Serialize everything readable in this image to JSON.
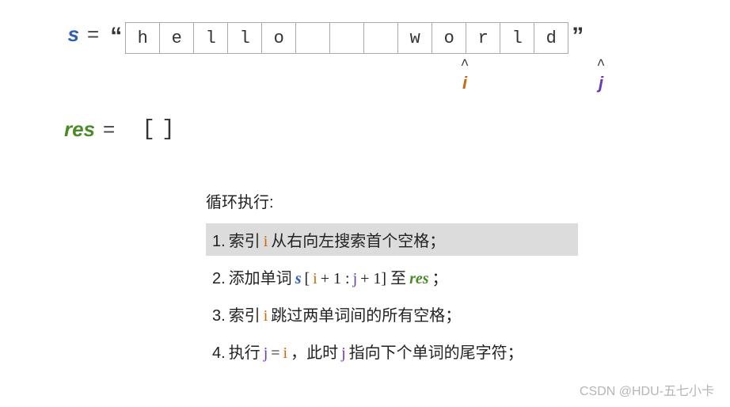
{
  "top": {
    "var_s": "s",
    "eq": "=",
    "open_quote": "“",
    "close_quote": "”",
    "cells": [
      "h",
      "e",
      "l",
      "l",
      "o",
      "",
      "",
      "",
      "w",
      "o",
      "r",
      "l",
      "d"
    ],
    "pointers": [
      {
        "index": 8,
        "caret": "^",
        "label": "i",
        "cls": "col-i"
      },
      {
        "index": 12,
        "caret": "^",
        "label": "j",
        "cls": "col-j"
      }
    ]
  },
  "res": {
    "var": "res",
    "eq": "=",
    "value": "[]"
  },
  "steps": {
    "title": "循环执行:",
    "items": [
      {
        "n": "1.",
        "pre": "索引 ",
        "var": "i",
        "varcls": "col-i",
        "post": " 从右向左搜索首个空格；",
        "hl": true
      },
      {
        "n": "2.",
        "pre": "添加单词 ",
        "expr_html": true,
        "s": "s",
        "i": "i",
        "j": "j",
        "res": "res",
        "mid1": "[",
        "mid2": " + 1 : ",
        "mid3": " + 1] 至 ",
        "end": " ；",
        "hl": false
      },
      {
        "n": "3.",
        "pre": "索引 ",
        "var": "i",
        "varcls": "col-i",
        "post": " 跳过两单词间的所有空格；",
        "hl": false
      },
      {
        "n": "4.",
        "pre": "执行 ",
        "assign": true,
        "j": "j",
        "i": "i",
        "eq": " = ",
        "post2": "，此时 ",
        "j2": "j",
        "tail": " 指向下个单词的尾字符；",
        "hl": false
      }
    ]
  },
  "watermark": "CSDN @HDU-五七小卡"
}
